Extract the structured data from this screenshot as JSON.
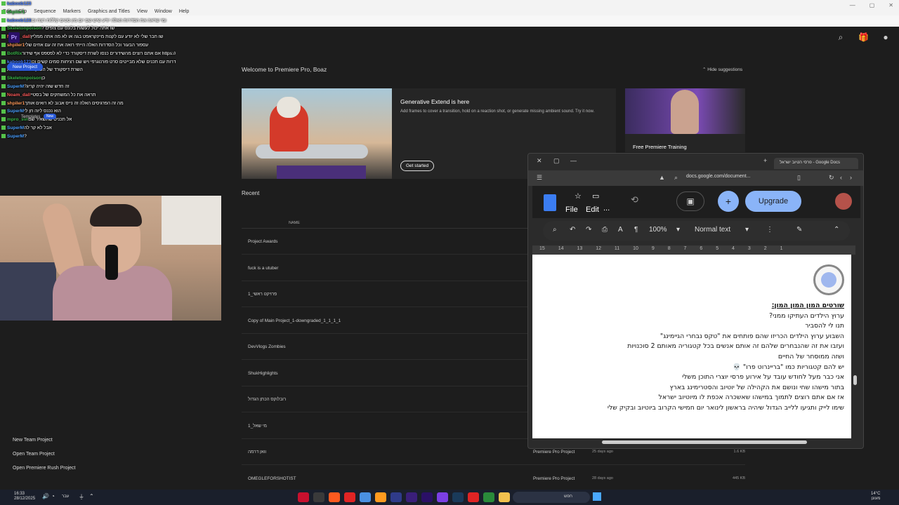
{
  "window": {
    "app_title": "Premiere Pro",
    "menus": [
      "Edit",
      "Clip",
      "Sequence",
      "Markers",
      "Graphics and Titles",
      "View",
      "Window",
      "Help"
    ]
  },
  "chat": [
    {
      "user": "kaboob123",
      "color": "#4a7fff",
      "msg": ""
    },
    {
      "user": "shpiler1",
      "color": "#3ab54a",
      "msg": ""
    },
    {
      "user": "kaboob123",
      "color": "#4a7fff",
      "msg": "ומי שראה את הסדרות האלה יודע שיש שם יום מין סטים קללות רצח וכו"
    },
    {
      "user": "Skeletonpoison",
      "color": "#3ab54a",
      "msg": "? שו אתה יכול לעשות בלונס עם צופים"
    },
    {
      "user": "Noam_dall",
      "color": "#ff5a5a",
      "msg": "שו חבר שלי לא יודע עם לקנות מיינקראפט בגה או לא מה אתה ממליץ"
    },
    {
      "user": "shpiler1",
      "color": "#ff9a5a",
      "msg": "עספור הבעור וכל הסדרות האלה הייתי רואה את זה עם אחים שלי"
    },
    {
      "user": "BotRix",
      "color": "#3ab54a",
      "msg": "אם אתם רוצים מהשידורים כנסו לשרת דיסקורד כדי לא לפספס אף שידור https://discord.gg/rs6tD7ghft"
    },
    {
      "user": "kaboob123",
      "color": "#4a7fff",
      "msg": "זה סדרות עם תכנים שלא מבייטים סרט פורנוגרפי ויש שם רציחות סמים קשים וכו"
    },
    {
      "user": "",
      "color": "#ffffff",
      "msg": "השרת דיסקורד של השוק בתכלס מתרת"
    },
    {
      "user": "Skeletonpoison",
      "color": "#3ab54a",
      "msg": "כן"
    },
    {
      "user": "SuperM",
      "color": "#4a9fff",
      "msg": "?זה חדש שזה יהיה קריג"
    },
    {
      "user": "Noam_dall",
      "color": "#ff5a5a",
      "msg": "תראה את כל המשחקים של בסטיי"
    },
    {
      "user": "shpiler1",
      "color": "#ff9a5a",
      "msg": "מה זה הפרגיסים האלה זה נייס אבוב לא רואים אותך"
    },
    {
      "user": "SuperM",
      "color": "#4a9fff",
      "msg": "הוא נכנס ליוה חן לי"
    },
    {
      "user": "mpro_svr",
      "color": "#3ab54a",
      "msg": "אל תכניס שתשאיר שם"
    },
    {
      "user": "SuperM",
      "color": "#4a9fff",
      "msg": "אבל לא קר לה"
    },
    {
      "user": "SuperM",
      "color": "#4a9fff",
      "msg": "?"
    }
  ],
  "overlay": {
    "pr_logo": "Pr",
    "new_project": "New Project",
    "templates": "Templates",
    "new_badge": "New"
  },
  "left_menu": [
    "New Team Project",
    "Open Team Project",
    "Open Premiere Rush Project"
  ],
  "home": {
    "welcome": "Welcome to Premiere Pro, Boaz",
    "hide_suggestions": "Hide suggestions",
    "card1_title": "Generative Extend is here",
    "card1_desc": "Add frames to cover a transition, hold on a reaction shot, or generate missing ambient sound. Try it now.",
    "card1_button": "Get started",
    "card2_title": "Free Premiere Training",
    "recent": "Recent",
    "col_name": "NAME"
  },
  "projects": [
    {
      "name": "Project Awards",
      "type": "",
      "date": "",
      "size": ""
    },
    {
      "name": "fuck is a utuber",
      "type": "",
      "date": "",
      "size": ""
    },
    {
      "name": "פרויקט ראשי_1",
      "type": "",
      "date": "",
      "size": ""
    },
    {
      "name": "Copy of Main Project_1-downgraded_1_1_1_1",
      "type": "",
      "date": "",
      "size": ""
    },
    {
      "name": "DevVlogs Zombies",
      "type": "",
      "date": "",
      "size": ""
    },
    {
      "name": "ShukHighlights",
      "type": "",
      "date": "",
      "size": ""
    },
    {
      "name": "רובלוקס הכתן הגדול",
      "type": "",
      "date": "",
      "size": ""
    },
    {
      "name": "מי שאל_1",
      "type": "",
      "date": "",
      "size": ""
    },
    {
      "name": "וואן דרמה",
      "type": "Premiere Pro Project",
      "date": "25 days ago",
      "size": "1.6 KB"
    },
    {
      "name": "OMEGLEFORSHOTIST",
      "type": "Premiere Pro Project",
      "date": "28 days ago",
      "size": "445 KB"
    }
  ],
  "browser": {
    "tab_title": "פרסי הטיוב ישראל - Google Docs",
    "url": "docs.google.com/document...",
    "menu_file": "File",
    "menu_edit": "Edit",
    "menu_more": "...",
    "upgrade": "Upgrade",
    "zoom": "100%",
    "style": "Normal text",
    "ruler": "15 14 13 12 11 10 9 8 7 6 5 4 3 2 1"
  },
  "doc_lines": [
    {
      "text": "שורטים המון המון המון:",
      "title": true
    },
    {
      "text": "ערוץ הילדים העתיקו ממני?",
      "title": false
    },
    {
      "text": "תנו לי להסביר",
      "title": false
    },
    {
      "text": "השבוע ערוץ הילדים הכריזו שהם פותחים את \"טקס נבחרי הגיימינג\"",
      "title": false
    },
    {
      "text": "ועזבו את זה שהנבחרים שלהם זה אותם אנשים בכל קטגוריה מאותם 2 סוכנויות",
      "title": false
    },
    {
      "text": "ושזה ממוסחר של החיים",
      "title": false
    },
    {
      "text": "יש להם קטגוריות כמו \"בריינרוט פרו\" 💀",
      "title": false
    },
    {
      "text": "אני כבר מעל לחודש עובד על אירוע פרסי יוצרי התוכן משלי",
      "title": false
    },
    {
      "text": "בתור מישהו שחי ונושם את הקהילה של יוטיוב והסטרימינג בארץ",
      "title": false
    },
    {
      "text": "אז אם אתם רוצים לתמוך במישהו שאשכרה אכפת לו מיוטיוב ישראל",
      "title": false
    },
    {
      "text": "שימו לייק ותגיעו ללייב הגדול שיהיה בראשון לינואר יום חמישי הקרוב ביוטיוב ובקיק שלי",
      "title": false
    }
  ],
  "taskbar": {
    "time": "16:33",
    "date": "28/12/2025",
    "lang": "עבר",
    "search": "חפש",
    "temp": "14°C",
    "weather": "מעונן"
  }
}
